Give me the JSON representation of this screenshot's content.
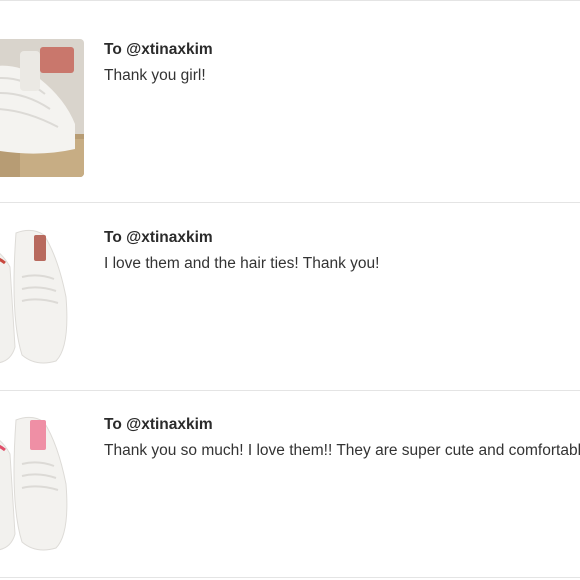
{
  "comments": [
    {
      "recipient": "To @xtinaxkim",
      "message": "Thank you girl!",
      "image_icon": "sneaker-photo-icon",
      "accent_color": "#c9776c"
    },
    {
      "recipient": "To @xtinaxkim",
      "message": "I love them and the hair ties! Thank you!",
      "image_icon": "sneaker-photo-icon",
      "accent_color": "#b86a5e"
    },
    {
      "recipient": "To @xtinaxkim",
      "message": "Thank you so much! I love them!! They are super cute and comfortable",
      "image_icon": "sneaker-photo-icon",
      "accent_color": "#ef8fa5"
    }
  ]
}
